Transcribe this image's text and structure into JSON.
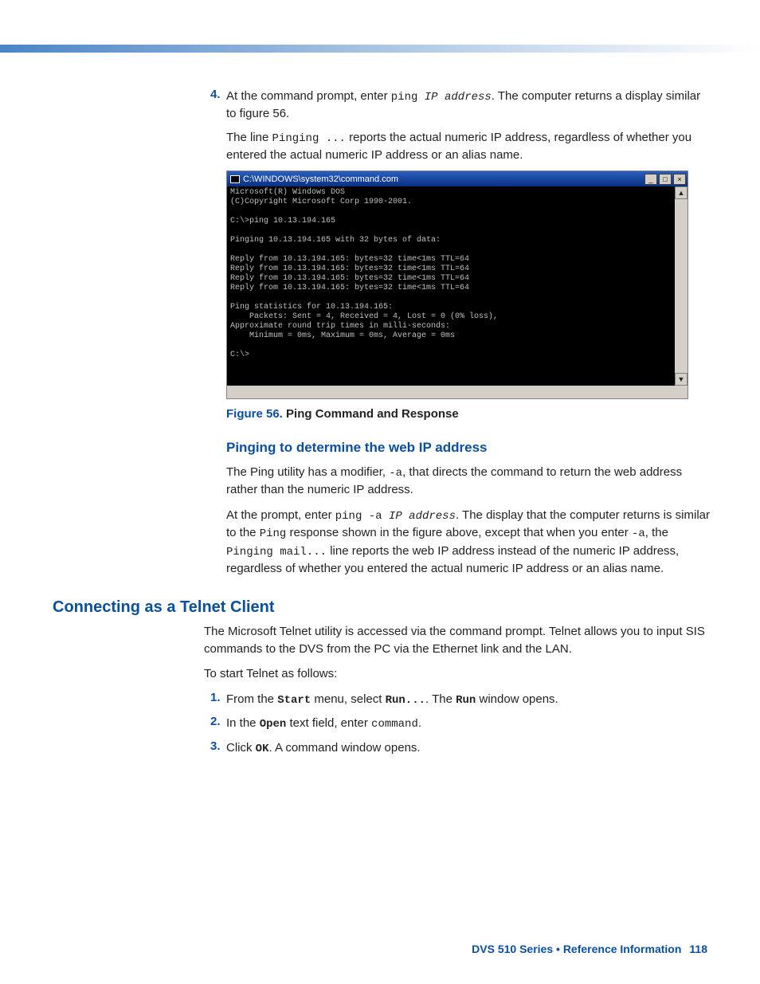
{
  "step4": {
    "num": "4.",
    "pre": "At the command prompt, enter ",
    "cmd": "ping ",
    "arg": "IP address",
    "post": ". The computer returns a display similar to figure 56.",
    "para2_pre": "The line ",
    "para2_code": "Pinging ...",
    "para2_post": " reports the actual numeric IP address, regardless of whether you entered the actual numeric IP address or an alias name."
  },
  "cmdwin": {
    "title": "C:\\WINDOWS\\system32\\command.com",
    "min": "_",
    "max": "□",
    "close": "×",
    "up": "▲",
    "down": "▼",
    "text": "Microsoft(R) Windows DOS\n(C)Copyright Microsoft Corp 1990-2001.\n\nC:\\>ping 10.13.194.165\n\nPinging 10.13.194.165 with 32 bytes of data:\n\nReply from 10.13.194.165: bytes=32 time<1ms TTL=64\nReply from 10.13.194.165: bytes=32 time<1ms TTL=64\nReply from 10.13.194.165: bytes=32 time<1ms TTL=64\nReply from 10.13.194.165: bytes=32 time<1ms TTL=64\n\nPing statistics for 10.13.194.165:\n    Packets: Sent = 4, Received = 4, Lost = 0 (0% loss),\nApproximate round trip times in milli-seconds:\n    Minimum = 0ms, Maximum = 0ms, Average = 0ms\n\nC:\\>"
  },
  "figcap": {
    "label": "Figure 56.",
    "text": "  Ping Command and Response"
  },
  "h3a": "Pinging to determine the web IP address",
  "pingA": {
    "p1_pre": "The Ping utility has a modifier, ",
    "p1_code": "-a",
    "p1_post": ", that directs the command to return the web address rather than the numeric IP address.",
    "p2_pre": "At the prompt, enter ",
    "p2_cmd": "ping -a ",
    "p2_arg": "IP address",
    "p2_mid1": ". The display that the computer returns is similar to the ",
    "p2_ping": "Ping",
    "p2_mid2": " response shown in the figure above, except that when you enter ",
    "p2_code2": "-a",
    "p2_mid3": ", the ",
    "p2_code3": "Pinging mail...",
    "p2_post": " line reports the web IP address instead of the numeric IP address, regardless of whether you entered the actual numeric IP address or an alias name."
  },
  "h2": "Connecting as a Telnet Client",
  "telnet": {
    "p1": "The Microsoft Telnet utility is accessed via the command prompt. Telnet allows you to input SIS commands to the DVS from the PC via the Ethernet link and the LAN.",
    "p2": "To start Telnet as follows:",
    "s1": {
      "num": "1.",
      "a": "From the ",
      "b": "Start",
      "c": " menu, select ",
      "d": "Run...",
      "e": ". The ",
      "f": "Run",
      "g": " window opens."
    },
    "s2": {
      "num": "2.",
      "a": "In the ",
      "b": "Open",
      "c": " text field, enter ",
      "d": "command",
      "e": "."
    },
    "s3": {
      "num": "3.",
      "a": "Click ",
      "b": "OK",
      "c": ". A command window opens."
    }
  },
  "footer": {
    "prod": "DVS 510 Series • ",
    "sec": "Reference Information",
    "page": "118"
  }
}
